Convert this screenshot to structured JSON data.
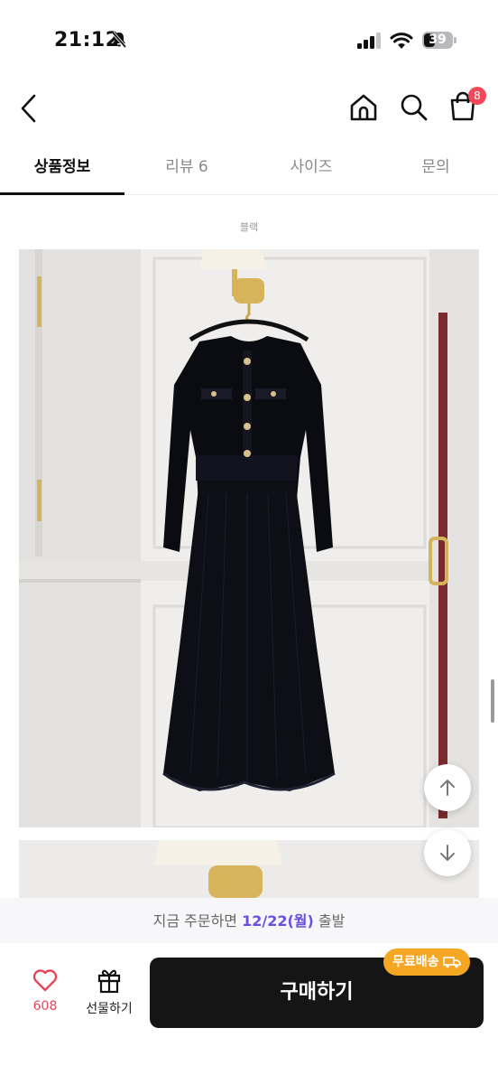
{
  "status_bar": {
    "time": "21:12",
    "battery": "39"
  },
  "header": {
    "cart_count": "8"
  },
  "tabs": [
    {
      "label": "상품정보"
    },
    {
      "label": "리뷰 6"
    },
    {
      "label": "사이즈"
    },
    {
      "label": "문의"
    }
  ],
  "product": {
    "color_caption": "블랙"
  },
  "shipping": {
    "prefix": "지금 주문하면 ",
    "date": "12/22(월)",
    "suffix": " 출발"
  },
  "bottom_bar": {
    "like_count": "608",
    "gift_label": "선물하기",
    "buy_label": "구매하기",
    "free_shipping_label": "무료배송"
  },
  "colors": {
    "accent": "#6a4fe0",
    "badge": "#f0475a",
    "like": "#e8455a",
    "free_shipping": "#f5a623",
    "buy_button": "#151515"
  }
}
